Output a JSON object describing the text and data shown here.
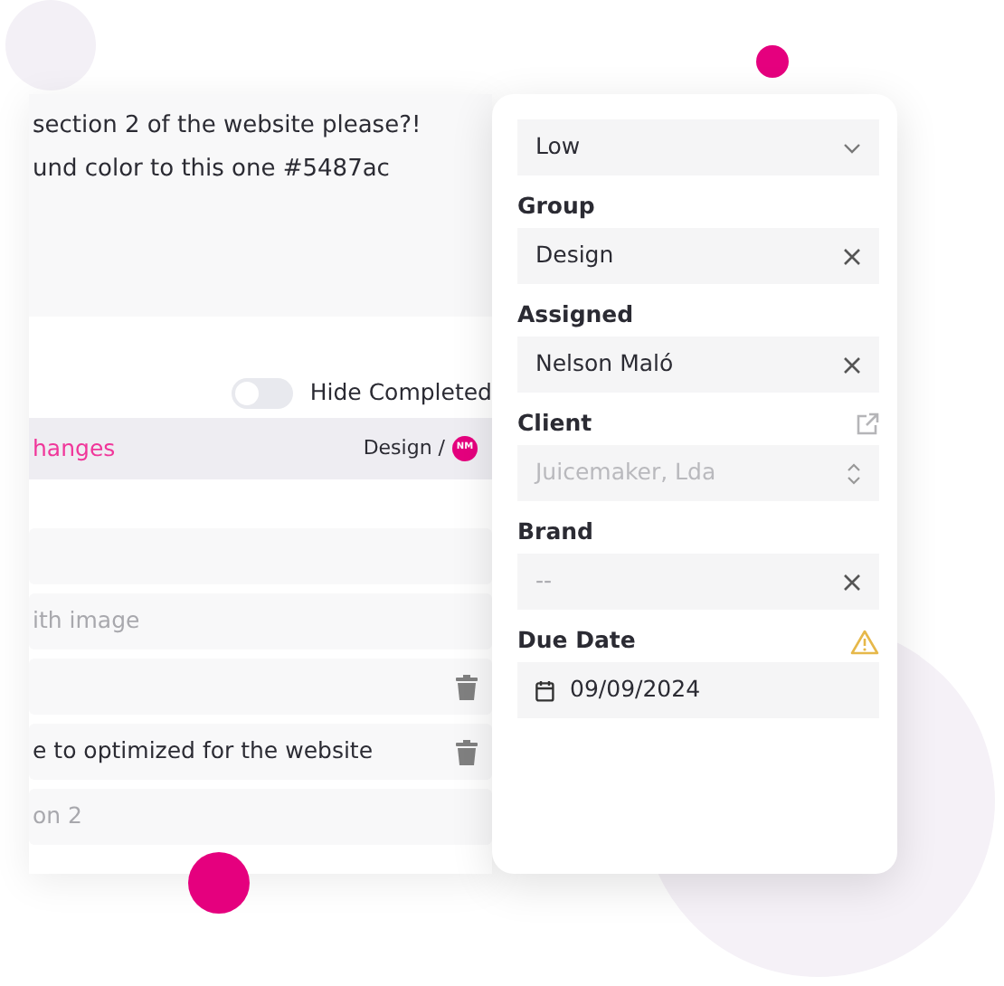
{
  "message": {
    "lines": [
      "section 2 of the website please?!",
      "und color to this one #5487ac"
    ]
  },
  "hide_completed": {
    "label": "Hide Completed",
    "on": false
  },
  "tasks": [
    {
      "kind": "header",
      "title": "hanges",
      "group": "Design /",
      "avatar": "NM",
      "selected": true,
      "deletable": false
    },
    {
      "kind": "blank",
      "deletable": false
    },
    {
      "kind": "muted",
      "title": "ith image",
      "deletable": false
    },
    {
      "kind": "blank",
      "deletable": true
    },
    {
      "kind": "text",
      "title": "e to optimized for the website",
      "deletable": true
    },
    {
      "kind": "muted",
      "title": "on 2",
      "deletable": false
    }
  ],
  "fields": [
    {
      "kind": "select",
      "value": "Low"
    },
    {
      "kind": "clearable",
      "label": "Group",
      "value": "Design"
    },
    {
      "kind": "clearable",
      "label": "Assigned",
      "value": "Nelson Maló"
    },
    {
      "kind": "link",
      "label": "Client",
      "value": "Juicemaker, Lda",
      "disabled": true
    },
    {
      "kind": "clearable",
      "label": "Brand",
      "placeholder": "--"
    },
    {
      "kind": "date",
      "label": "Due Date",
      "value": "09/09/2024",
      "warning": true
    }
  ]
}
